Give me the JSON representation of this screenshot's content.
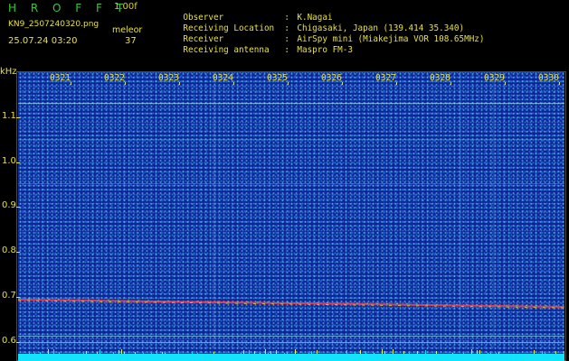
{
  "header": {
    "app_title": "H R O F F T",
    "version": "1.00f",
    "filename": "KN9_2507240320.png",
    "meteor_label": "meleor",
    "timestamp": "25.07.24 03:20",
    "meteor_count": "37"
  },
  "info": [
    {
      "label": "Observer",
      "sep": ":",
      "value": "K.Nagai"
    },
    {
      "label": "Receiving Location",
      "sep": ":",
      "value": "Chigasaki, Japan (139.414 35.340)"
    },
    {
      "label": "Receiver",
      "sep": ":",
      "value": "AirSpy mini (Miakejima VOR 108.65MHz)"
    },
    {
      "label": "Receiving antenna",
      "sep": ":",
      "value": "Maspro FM-3"
    }
  ],
  "axis": {
    "unit": "kHz",
    "y_ticks": [
      "1.1",
      "1.0",
      "0.9",
      "0.8",
      "0.7",
      "0.6"
    ],
    "x_ticks": [
      "0321",
      "0322",
      "0323",
      "0324",
      "0325",
      "0326",
      "0327",
      "0328",
      "0329",
      "0330"
    ]
  },
  "colors": {
    "background": "#000000",
    "text": "#e8e23a",
    "title": "#35c83a",
    "plot": "#0d2a9a",
    "carrier": "#ff5050"
  }
}
